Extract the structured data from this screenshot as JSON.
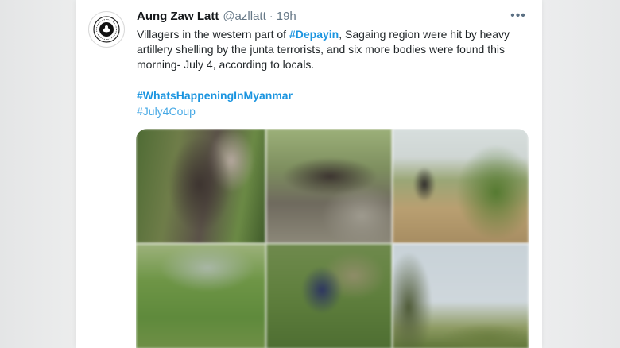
{
  "tweet": {
    "author_name": "Aung Zaw Latt",
    "author_handle": "@azllatt",
    "separator": "·",
    "timestamp": "19h",
    "more_label": "•••",
    "text_before": "Villagers in the western part of ",
    "text_hashtag": "#Depayin",
    "text_after": ", Sagaing region were hit by heavy artillery shelling by the junta terrorists, and six more bodies were found this morning- July 4, according to locals.",
    "hashtags": [
      "#WhatsHappeningInMyanmar",
      "#July4Coup"
    ]
  },
  "colors": {
    "link": "#1b95e0",
    "name": "#14171a",
    "muted": "#657786",
    "card_bg": "#ffffff",
    "page_bg": "#e9eaeb"
  },
  "media": {
    "photo_count": 6,
    "photos": [
      "photo-1",
      "photo-2",
      "photo-3",
      "photo-4",
      "photo-5",
      "photo-6"
    ]
  },
  "icons": {
    "avatar": "emblem-avatar-icon",
    "more": "more-options-icon"
  }
}
